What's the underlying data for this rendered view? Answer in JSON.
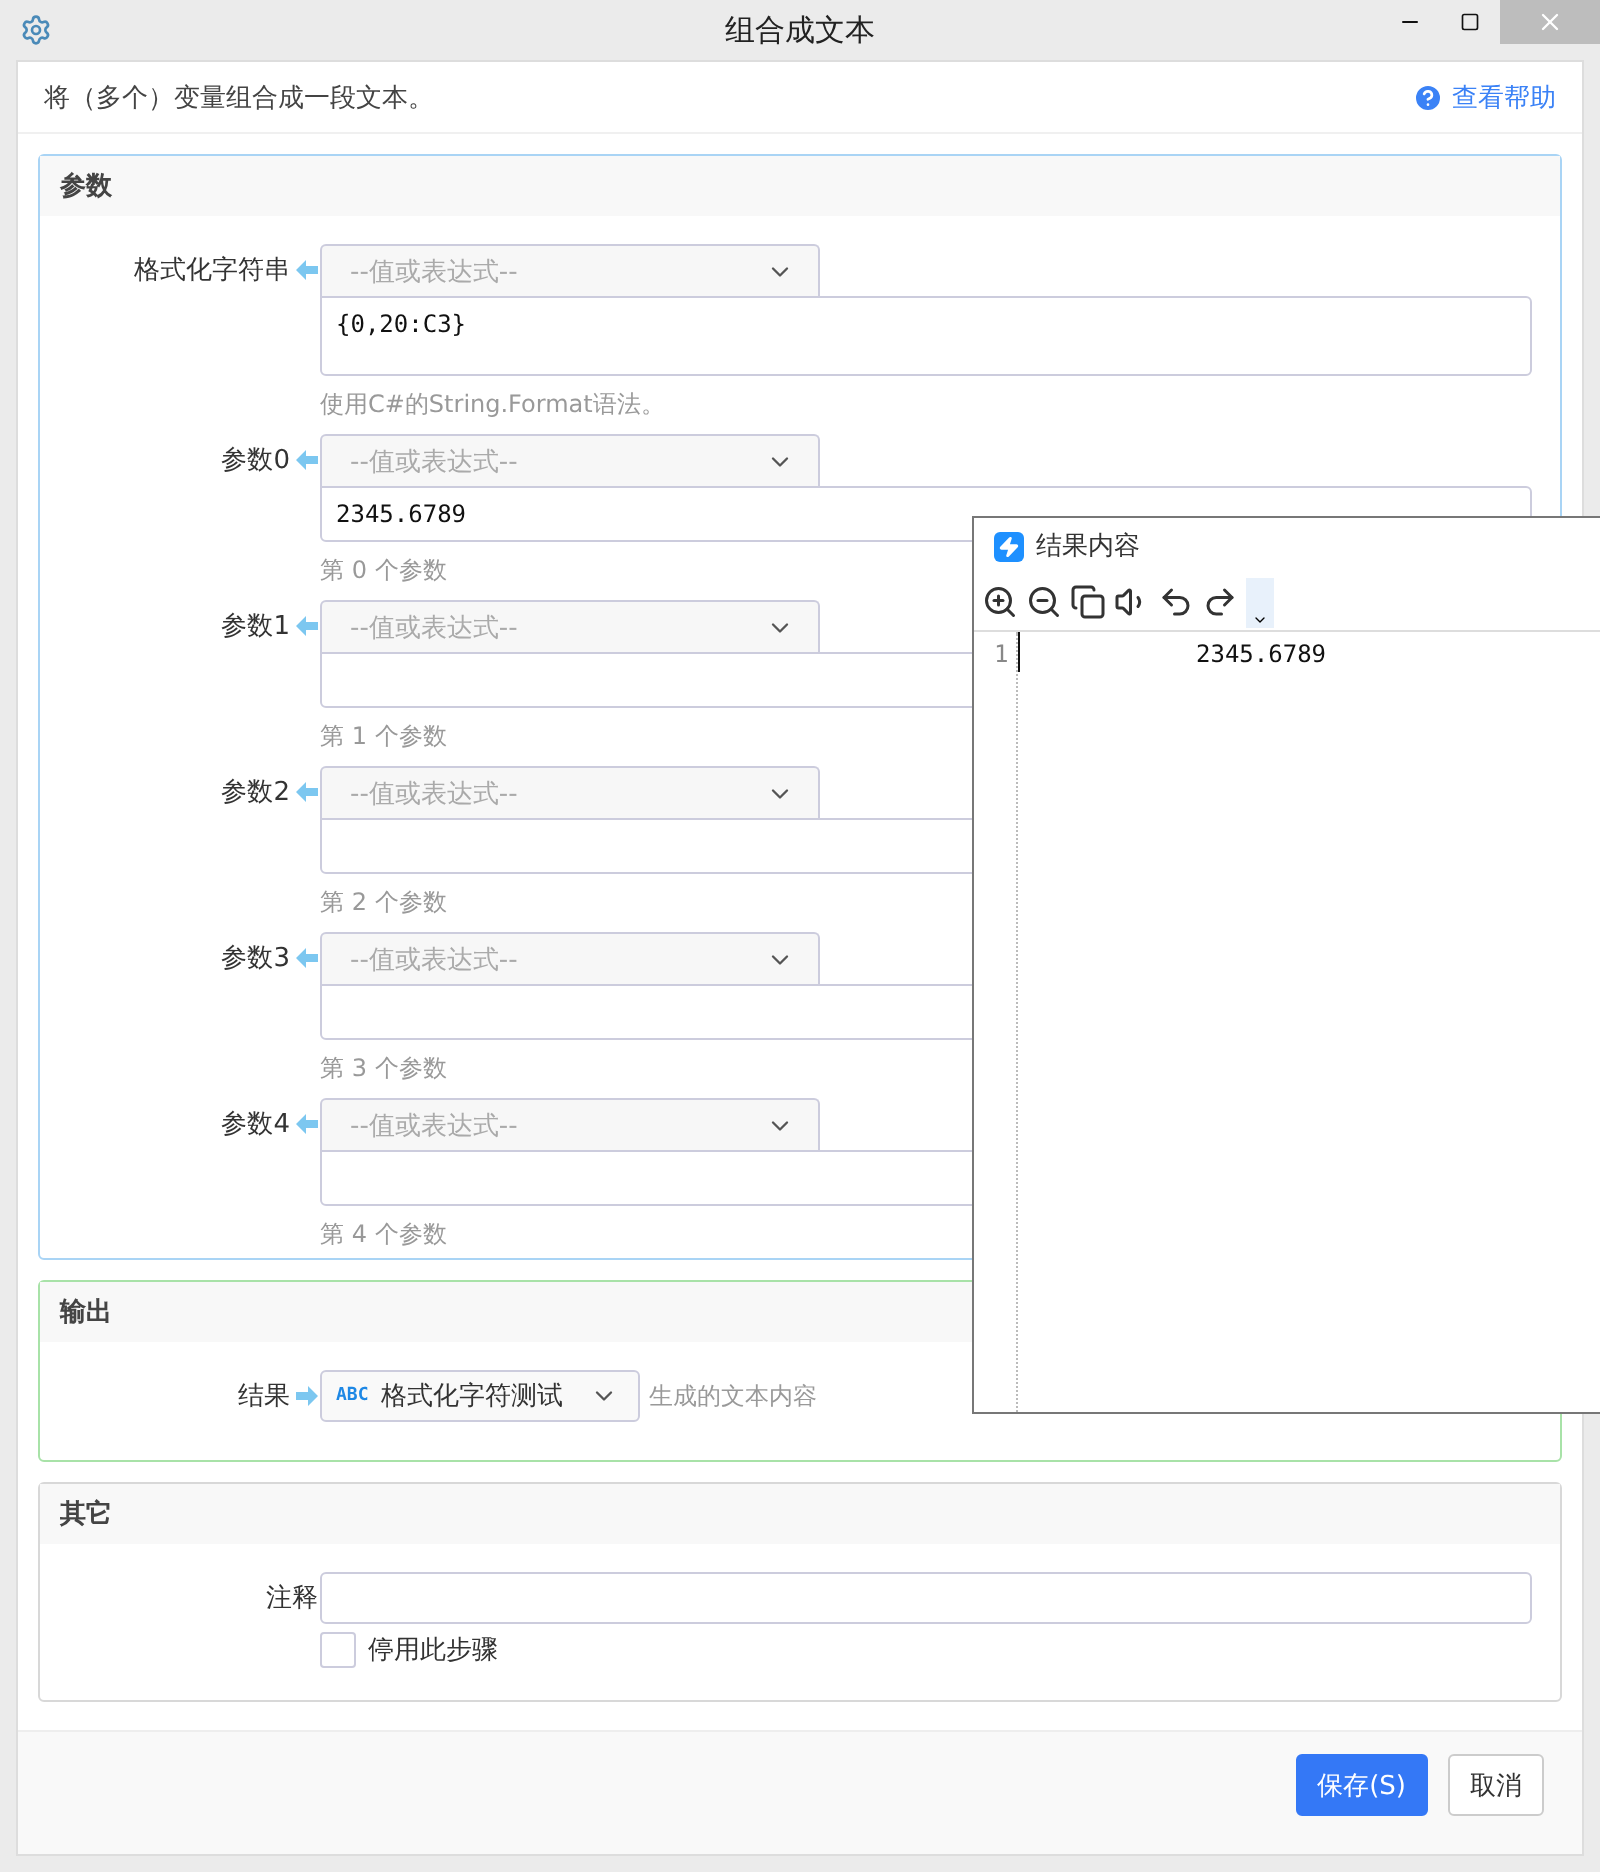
{
  "window": {
    "title": "组合成文本"
  },
  "description": "将（多个）变量组合成一段文本。",
  "help_link": "查看帮助",
  "params": {
    "title": "参数",
    "rows": [
      {
        "label": "格式化字符串",
        "placeholder": "--值或表达式--",
        "value": "{0,20:C3}",
        "multiline": true,
        "hint": "使用C#的String.Format语法。"
      },
      {
        "label": "参数0",
        "placeholder": "--值或表达式--",
        "value": "2345.6789",
        "multiline": false,
        "hint": "第 0 个参数"
      },
      {
        "label": "参数1",
        "placeholder": "--值或表达式--",
        "multiline": false,
        "hint": "第 1 个参数"
      },
      {
        "label": "参数2",
        "placeholder": "--值或表达式--",
        "multiline": false,
        "hint": "第 2 个参数"
      },
      {
        "label": "参数3",
        "placeholder": "--值或表达式--",
        "multiline": false,
        "hint": "第 3 个参数"
      },
      {
        "label": "参数4",
        "placeholder": "--值或表达式--",
        "multiline": false,
        "hint": "第 4 个参数"
      }
    ]
  },
  "output": {
    "title": "输出",
    "label": "结果",
    "type_tag": "ABC",
    "value": "格式化字符测试",
    "hint": "生成的文本内容"
  },
  "other": {
    "title": "其它",
    "note_label": "注释",
    "disable_checkbox": {
      "label": "停用此步骤",
      "checked": false
    }
  },
  "buttons": [
    {
      "label": "保存(S)",
      "kind": "primary"
    },
    {
      "label": "取消",
      "kind": "default"
    }
  ],
  "result_popup": {
    "title": "结果内容",
    "lines": [
      {
        "number": "1",
        "text": "2345.6789"
      }
    ]
  }
}
